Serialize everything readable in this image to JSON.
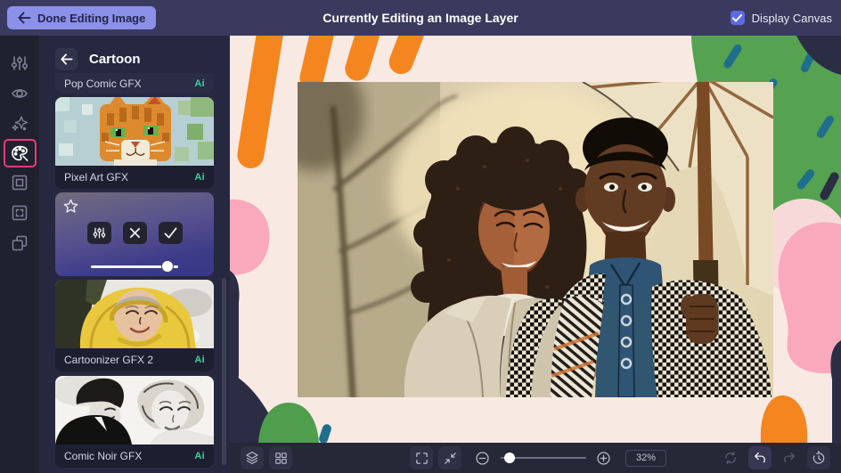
{
  "topbar": {
    "done_button_label": "Done Editing Image",
    "title": "Currently Editing an Image Layer",
    "display_canvas_label": "Display Canvas",
    "display_canvas_checked": true
  },
  "tool_rail": {
    "tools": [
      "adjust",
      "touchup",
      "effects",
      "artsy",
      "frames",
      "overlays",
      "graphics"
    ],
    "active_tool": "artsy"
  },
  "panel": {
    "title": "Cartoon",
    "items": [
      {
        "label": "Pop Comic GFX",
        "badge": "Ai"
      },
      {
        "label": "Pixel Art GFX",
        "badge": "Ai"
      },
      {
        "label": "Cartoonizer GFX 2",
        "badge": "Ai"
      },
      {
        "label": "Comic Noir GFX",
        "badge": "Ai"
      }
    ],
    "active_effect": {
      "strength_percent": 88
    }
  },
  "bottom_bar": {
    "zoom_label": "32%",
    "zoom_slider_percent": 10
  },
  "colors": {
    "topbar_bg": "#3a3a5e",
    "done_button_bg": "#8b90e9",
    "active_tool_border": "#ee3a7c",
    "ai_badge": "#3dd19e",
    "checkbox_blue": "#5b6ae4",
    "panel_bg": "#262840",
    "canvas_cream": "#f8e9e2",
    "blob_orange": "#f5861f",
    "blob_pink": "#f9a9bb",
    "blob_pink_light": "#f7d9d9",
    "blob_green": "#55a251",
    "blob_teal": "#1f6f8c",
    "blob_navy": "#2b2d45"
  }
}
